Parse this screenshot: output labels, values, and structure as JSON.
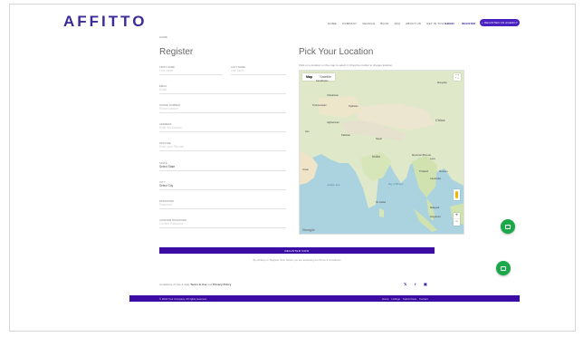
{
  "header": {
    "logo": "AFFITTO",
    "nav": [
      "HOME",
      "COMPANY",
      "VEHICLE",
      "BLOG",
      "FAQ",
      "ABOUT US",
      "GET IN TOUCH"
    ],
    "login": "LOGIN",
    "separator": "|",
    "register": "REGISTER",
    "agency_button": "+ REGISTER AN AGENCY",
    "brand_color": "#3b2a97"
  },
  "breadcrumb": "HOME",
  "form": {
    "title": "Register",
    "fields": [
      {
        "label": "FIRST NAME",
        "placeholder": "First name",
        "value": ""
      },
      {
        "label": "LAST NAME",
        "placeholder": "Last name",
        "value": ""
      },
      {
        "label": "EMAIL",
        "placeholder": "Email",
        "value": ""
      },
      {
        "label": "PHONE NUMBER",
        "placeholder": "Phone number",
        "value": ""
      },
      {
        "label": "ADDRESS",
        "placeholder": "Enter full address",
        "value": ""
      },
      {
        "label": "PINCODE",
        "placeholder": "Enter your Pincode",
        "value": ""
      },
      {
        "label": "STATE",
        "placeholder": "",
        "value": "Select State"
      },
      {
        "label": "CITY",
        "placeholder": "",
        "value": "Select City"
      },
      {
        "label": "PASSWORD",
        "placeholder": "Password",
        "value": ""
      },
      {
        "label": "CONFIRM PASSWORD",
        "placeholder": "Confirm Password",
        "value": ""
      }
    ]
  },
  "location": {
    "title": "Pick Your Location",
    "subtitle": "Click on a location on the map to select it. Drag the marker to change location.",
    "map_tabs": [
      "Map",
      "Satellite"
    ],
    "fullscreen_glyph": "⛶",
    "zoom_in": "+",
    "zoom_out": "−",
    "google": "Google",
    "map_footer": "",
    "labels": {
      "mongolia": "Mongolia",
      "kazakhstan": "Kazakhstan",
      "uzbekistan": "Uzbekistan",
      "turkmenistan": "Turkmenistan",
      "tajikistan": "Tajikistan",
      "afghanistan": "Afghanistan",
      "pakistan": "Pakistan",
      "nepal": "Nepal",
      "china": "China",
      "iran": "Iran",
      "india": "India",
      "myanmar": "Myanmar (Burma)",
      "oman": "Oman",
      "laos": "Laos",
      "thailand": "Thailand",
      "vietnam": "Vietnam",
      "cambodia": "Cambodia",
      "arabian_sea": "Arabian Sea",
      "bay_of_bengal": "Bay of Bengal",
      "sri_lanka": "Sri Lanka",
      "malaysia": "Malaysia",
      "singapore": "Singapore"
    }
  },
  "actions": {
    "register_now": "REGISTER NOW",
    "terms_note": "By clicking on 'Register Now' button you are accepting the Terms & Conditions"
  },
  "footer": {
    "prefix": "Conditions of Use & Sale",
    "terms_link": "Terms & Use",
    "and": "and",
    "privacy_link": "Privacy Policy",
    "social": [
      "𝕏",
      "f",
      "▣"
    ],
    "copyright": "© 2024 Your Company. All rights reserved.",
    "bottom_links": [
      "Home",
      "Listings",
      "Submit Now",
      "Contact"
    ]
  },
  "colors": {
    "accent": "#3a0ca3",
    "chat_green": "#1aa84b"
  }
}
